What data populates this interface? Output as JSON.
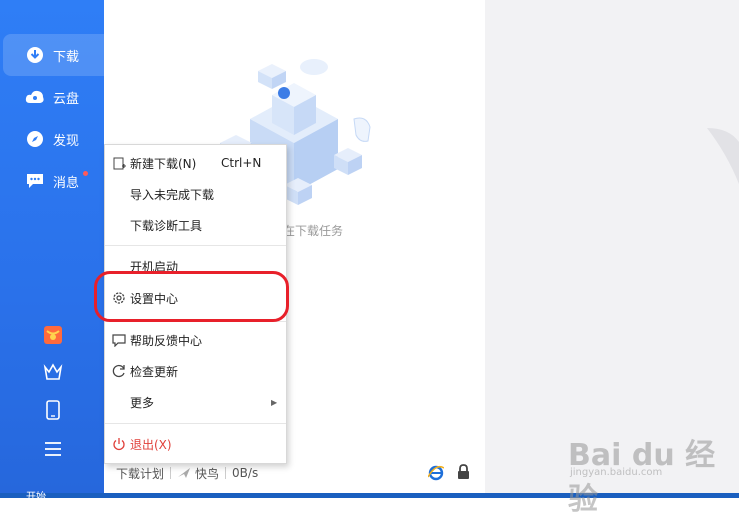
{
  "sidebar": {
    "items": [
      {
        "label": "下载",
        "icon": "download-icon",
        "active": true
      },
      {
        "label": "云盘",
        "icon": "cloud-icon"
      },
      {
        "label": "发现",
        "icon": "compass-icon"
      },
      {
        "label": "消息",
        "icon": "message-icon"
      }
    ],
    "bottom_icons": [
      "red-envelope-icon",
      "crown-icon",
      "phone-icon",
      "menu-icon"
    ]
  },
  "main": {
    "empty_text": "在下载任务"
  },
  "footer": {
    "plan": "下载计划",
    "bird": "快鸟",
    "speed": "0B/s"
  },
  "menu": {
    "items": [
      {
        "label": "新建下载(N)",
        "shortcut": "Ctrl+N",
        "icon": "new-download-icon"
      },
      {
        "label": "导入未完成下载"
      },
      {
        "label": "下载诊断工具"
      },
      {
        "label": "开机启动"
      },
      {
        "label": "设置中心",
        "icon": "gear-icon"
      },
      {
        "label": "帮助反馈中心",
        "icon": "feedback-icon"
      },
      {
        "label": "检查更新",
        "icon": "refresh-icon"
      },
      {
        "label": "更多"
      },
      {
        "label": "退出(X)",
        "icon": "power-icon"
      }
    ]
  },
  "taskbar": {
    "start_label": "开始"
  },
  "watermark": {
    "brand": "Bai du 经验",
    "url": "jingyan.baidu.com"
  },
  "colors": {
    "sidebar": "#2f7ef6",
    "highlight": "#e8202a",
    "exit": "#e0403a"
  }
}
